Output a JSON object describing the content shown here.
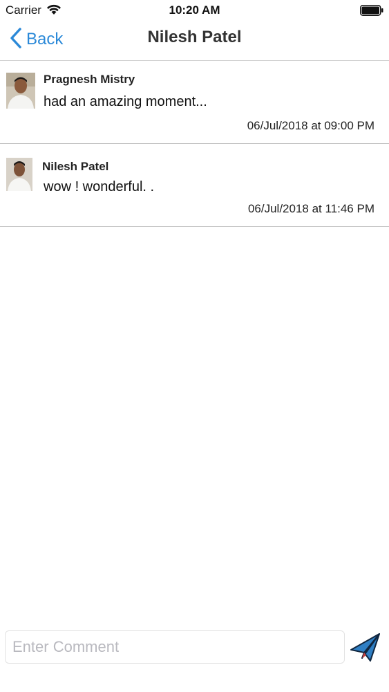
{
  "status_bar": {
    "carrier": "Carrier",
    "time": "10:20 AM"
  },
  "nav": {
    "back_label": "Back",
    "title": "Nilesh Patel"
  },
  "comments": [
    {
      "name": "Pragnesh Mistry",
      "text": "had an amazing moment...",
      "timestamp": "06/Jul/2018 at 09:00 PM"
    },
    {
      "name": "Nilesh Patel",
      "text": "wow ! wonderful. .",
      "timestamp": "06/Jul/2018 at 11:46 PM"
    }
  ],
  "composer": {
    "placeholder": "Enter Comment",
    "value": ""
  },
  "icons": {
    "back": "chevron-left-icon",
    "send": "paper-plane-icon",
    "wifi": "wifi-icon",
    "battery": "battery-icon"
  },
  "colors": {
    "accent": "#2b89d8",
    "send_icon": "#1f5f9e",
    "divider": "#bdbdbd"
  }
}
